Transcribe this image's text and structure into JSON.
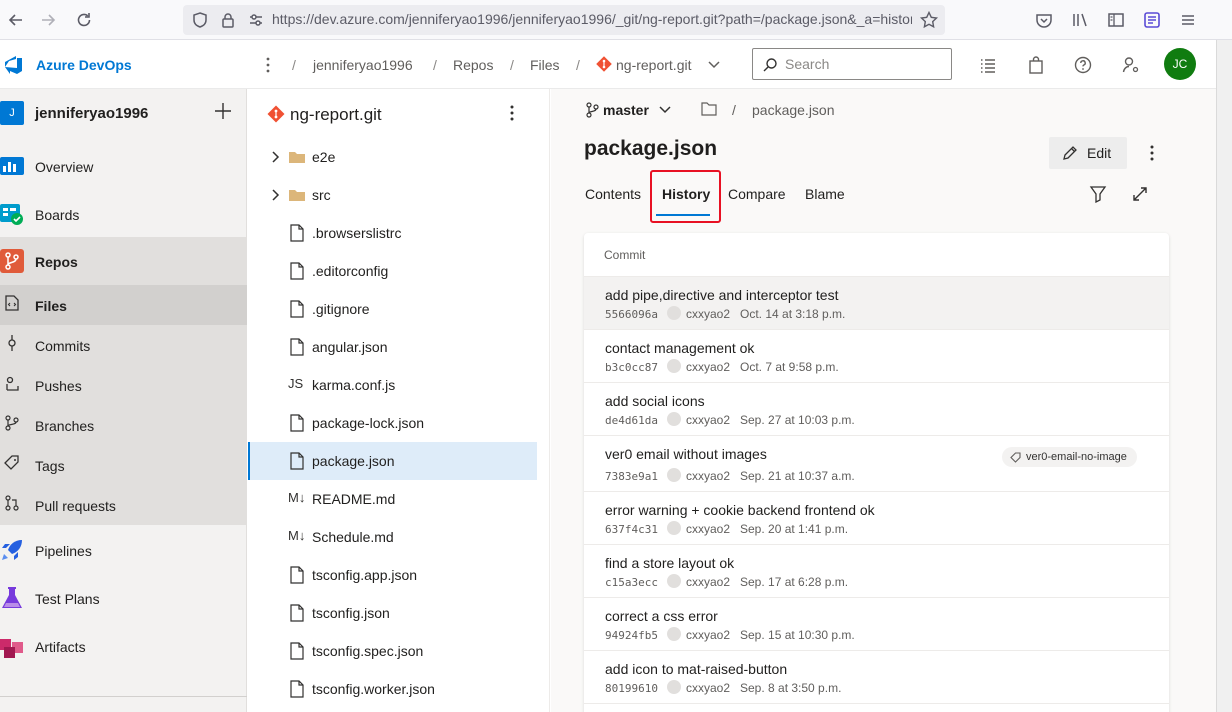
{
  "browser": {
    "url": "https://dev.azure.com/jenniferyao1996/jenniferyao1996/_git/ng-report.git?path=/package.json&_a=history"
  },
  "header": {
    "product": "Azure DevOps",
    "breadcrumbs": [
      "jenniferyao1996",
      "Repos",
      "Files",
      "ng-report.git"
    ],
    "search_placeholder": "Search",
    "avatar_initials": "JC"
  },
  "leftnav": {
    "project_badge": "J",
    "project_name": "jenniferyao1996",
    "items": [
      {
        "label": "Overview"
      },
      {
        "label": "Boards"
      },
      {
        "label": "Repos"
      },
      {
        "label": "Files"
      },
      {
        "label": "Commits"
      },
      {
        "label": "Pushes"
      },
      {
        "label": "Branches"
      },
      {
        "label": "Tags"
      },
      {
        "label": "Pull requests"
      },
      {
        "label": "Pipelines"
      },
      {
        "label": "Test Plans"
      },
      {
        "label": "Artifacts"
      }
    ]
  },
  "tree": {
    "repo_name": "ng-report.git",
    "items": [
      {
        "name": "e2e",
        "kind": "folder"
      },
      {
        "name": "src",
        "kind": "folder"
      },
      {
        "name": ".browserslistrc",
        "kind": "file"
      },
      {
        "name": ".editorconfig",
        "kind": "file"
      },
      {
        "name": ".gitignore",
        "kind": "file"
      },
      {
        "name": "angular.json",
        "kind": "file"
      },
      {
        "name": "karma.conf.js",
        "kind": "js",
        "icon_text": "JS"
      },
      {
        "name": "package-lock.json",
        "kind": "file"
      },
      {
        "name": "package.json",
        "kind": "file",
        "selected": true
      },
      {
        "name": "README.md",
        "kind": "md",
        "icon_text": "M↓"
      },
      {
        "name": "Schedule.md",
        "kind": "md",
        "icon_text": "M↓"
      },
      {
        "name": "tsconfig.app.json",
        "kind": "file"
      },
      {
        "name": "tsconfig.json",
        "kind": "file"
      },
      {
        "name": "tsconfig.spec.json",
        "kind": "file"
      },
      {
        "name": "tsconfig.worker.json",
        "kind": "file"
      }
    ]
  },
  "main": {
    "branch": "master",
    "path_separator": "/",
    "path_file": "package.json",
    "file_title": "package.json",
    "edit_label": "Edit",
    "tabs": [
      {
        "label": "Contents"
      },
      {
        "label": "History",
        "active": true
      },
      {
        "label": "Compare"
      },
      {
        "label": "Blame"
      }
    ],
    "commit_header": "Commit",
    "commits": [
      {
        "message": "add pipe,directive and interceptor test",
        "hash": "5566096a",
        "author": "cxxyao2",
        "date": "Oct. 14 at 3:18 p.m."
      },
      {
        "message": "contact management ok",
        "hash": "b3c0cc87",
        "author": "cxxyao2",
        "date": "Oct. 7 at 9:58 p.m."
      },
      {
        "message": "add social icons",
        "hash": "de4d61da",
        "author": "cxxyao2",
        "date": "Sep. 27 at 10:03 p.m."
      },
      {
        "message": "ver0 email without images",
        "hash": "7383e9a1",
        "author": "cxxyao2",
        "date": "Sep. 21 at 10:37 a.m.",
        "tag": "ver0-email-no-image"
      },
      {
        "message": "error warning + cookie backend frontend ok",
        "hash": "637f4c31",
        "author": "cxxyao2",
        "date": "Sep. 20 at 1:41 p.m."
      },
      {
        "message": "find a store layout ok",
        "hash": "c15a3ecc",
        "author": "cxxyao2",
        "date": "Sep. 17 at 6:28 p.m."
      },
      {
        "message": "correct a css error",
        "hash": "94924fb5",
        "author": "cxxyao2",
        "date": "Sep. 15 at 10:30 p.m."
      },
      {
        "message": "add icon to mat-raised-button",
        "hash": "80199610",
        "author": "cxxyao2",
        "date": "Sep. 8 at 3:50 p.m."
      }
    ]
  },
  "colors": {
    "accent": "#0078d4",
    "highlight": "#e81123",
    "avatar": "#107c10",
    "git": "#f05133"
  }
}
